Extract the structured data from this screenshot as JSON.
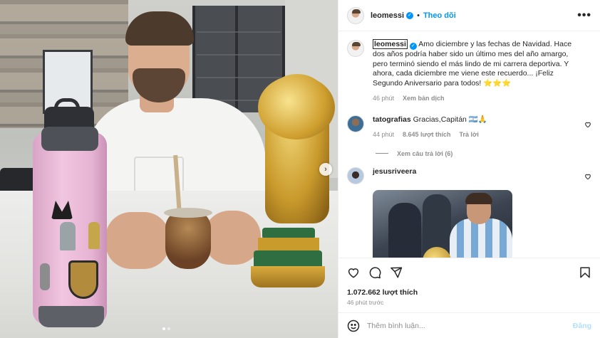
{
  "post": {
    "username": "leomessi",
    "follow_label": "Theo dõi",
    "more_label": "•••",
    "verified_glyph": "✓",
    "separator": "•",
    "caption": "Amo diciembre y las fechas de Navidad. Hace dos años podría haber sido un último mes del año amargo, pero terminó siendo el más lindo de mi carrera deportiva. Y ahora, cada diciembre me viene este recuerdo... ¡Feliz Segundo Aniversario para todos! ⭐⭐⭐",
    "caption_time": "46 phút",
    "see_translation": "Xem bản dịch",
    "likes": "1.072.662 lượt thích",
    "posted_ago": "46 phút trước",
    "media": {
      "slide_count": 2,
      "active_slide": 1,
      "next_icon": "chevron-right-icon"
    }
  },
  "comments": [
    {
      "username": "tatografias",
      "text": "Gracias,Capitán 🇦🇷🙏",
      "time": "44 phút",
      "likes": "8.645 lượt thích",
      "reply_label": "Trả lời",
      "view_replies": "Xem câu trả lời (6)"
    },
    {
      "username": "jesusriveera",
      "has_image": true
    }
  ],
  "actions": {
    "like_icon": "heart-icon",
    "comment_icon": "comment-icon",
    "share_icon": "share-icon",
    "save_icon": "bookmark-icon"
  },
  "composer": {
    "emoji_icon": "emoji-icon",
    "placeholder": "Thêm bình luận...",
    "post_label": "Đăng"
  },
  "colors": {
    "accent": "#0095f6",
    "muted": "#8e8e8e",
    "text": "#262626",
    "post_disabled": "#b2dffc"
  }
}
